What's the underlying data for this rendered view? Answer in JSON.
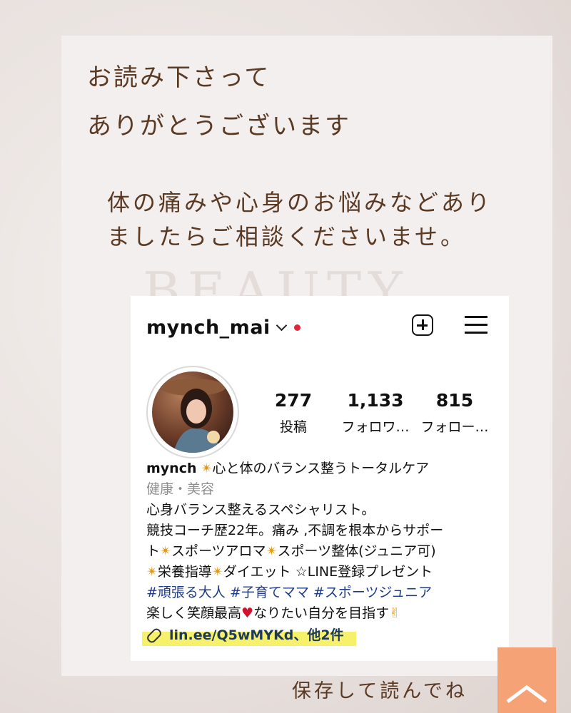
{
  "note": {
    "thanks_line1": "お読み下さって",
    "thanks_line2": "ありがとうございます",
    "ask_text": "体の痛みや心身のお悩みなどありましたらご相談くださいませ。",
    "watermark": "BEAUTY",
    "save_label": "保存して読んでね"
  },
  "profile": {
    "username": "mynch_mai",
    "stats": [
      {
        "value": "277",
        "label": "投稿"
      },
      {
        "value": "1,133",
        "label": "フォロワ…"
      },
      {
        "value": "815",
        "label": "フォロー…"
      }
    ],
    "display_name": "mynch",
    "star": "✴",
    "name_suffix": "心と体のバランス整うトータルケア",
    "category": "健康・美容",
    "bio_line1": "心身バランス整えるスペシャリスト。",
    "bio_line2": "競技コーチ歴22年。痛み ,不調を根本からサポー",
    "bio_line3a": "ト",
    "bio_line3b": "スポーツアロマ",
    "bio_line3c": "スポーツ整体(ジュニア可)",
    "bio_line4a": "栄養指導",
    "bio_line4b": "ダイエット ☆LINE登録プレゼント",
    "hashtags": "#頑張る大人 #子育てママ #スポーツジュニア",
    "bio_line5a": "楽しく笑顔最高",
    "heart": "♥",
    "bio_line5b": "なりたい自分を目指す",
    "peace": "✌",
    "link": "lin.ee/Q5wMYKd、他2件"
  },
  "colors": {
    "handwriting": "#5b3a24",
    "highlight": "#f7f06a",
    "ribbon": "#f5a277",
    "notification_dot": "#e0283c"
  }
}
